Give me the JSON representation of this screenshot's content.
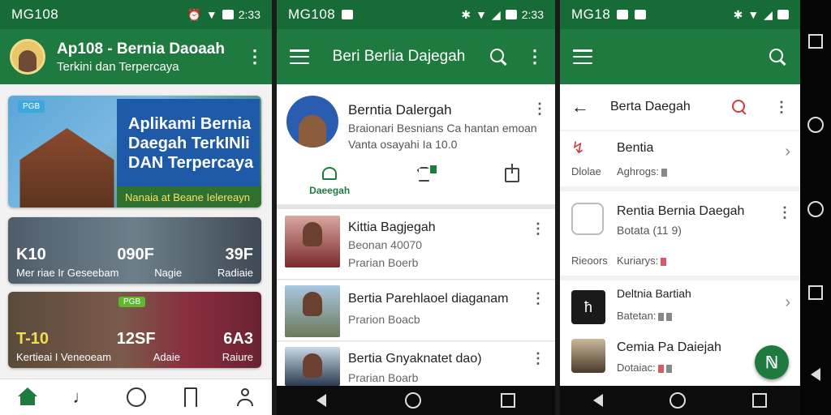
{
  "screen1": {
    "status": {
      "carrier": "MG108",
      "time": "2:33"
    },
    "header": {
      "title": "Ap108 - Bernia Daoaah",
      "subtitle": "Terkini dan Terpercaya"
    },
    "hero": {
      "tag": "PGB",
      "headline_line1": "Aplikami Bernia",
      "headline_line2": "Daegah TerkINli",
      "headline_line3": "DAN Terpercaya",
      "caption": "Nanaia at Beane Ielereayn"
    },
    "tile1": {
      "left_big": "K10",
      "mid_big": "090F",
      "right_big": "39F",
      "left_small": "Mer riae Ir Geseebam",
      "mid_small": "Nagie",
      "right_small": "Radiaie"
    },
    "tile2": {
      "badge": "PGB",
      "left_big": "T-10",
      "mid_big": "12SF",
      "right_big": "6A3",
      "left_small": "Kertieai I Veneoeam",
      "mid_small": "Adaie",
      "right_small": "Raiure"
    }
  },
  "screen2": {
    "status": {
      "carrier": "MG108",
      "time": "2:33"
    },
    "header": {
      "title": "Beri Berlia Dajegah"
    },
    "profile": {
      "name": "Berntia Dalergah",
      "line1": "Braionari Besnians Ca hantan emoan",
      "line2": "Vanta osayahi Ia 10.0"
    },
    "actions": {
      "news_label": "Daeegah"
    },
    "news": [
      {
        "title": "Kittia Bagjegah",
        "sub": "Beonan 40070",
        "sub2": "Prarian Boerb"
      },
      {
        "title": "Bertia Parehlaoel diaganam",
        "sub": "Prarion Boacb"
      },
      {
        "title": "Bertia Gnyaknatet dao)",
        "sub": "Prarian Boarb"
      }
    ]
  },
  "screen3": {
    "status": {
      "carrier": "MG18"
    },
    "header": {
      "title": "Berta Daegah"
    },
    "sec1": {
      "title": "Bentia",
      "left_label": "Dlolae",
      "sub": "Aghrogs:"
    },
    "sec2": {
      "title": "Rentia Bernia Daegah",
      "sub": "Botata (11 9)",
      "left_label": "Rieoors",
      "sub2": "Kuriarys:"
    },
    "sec3a": {
      "title": "Deltnia Bartiah",
      "sub": "Batetan:"
    },
    "sec3b": {
      "title": "Cemia Pa Daiejah",
      "sub": "Dotaiac:"
    }
  },
  "colors": {
    "primary": "#1e7a3e",
    "status": "#176b37",
    "accent_red": "#d63a3a"
  }
}
